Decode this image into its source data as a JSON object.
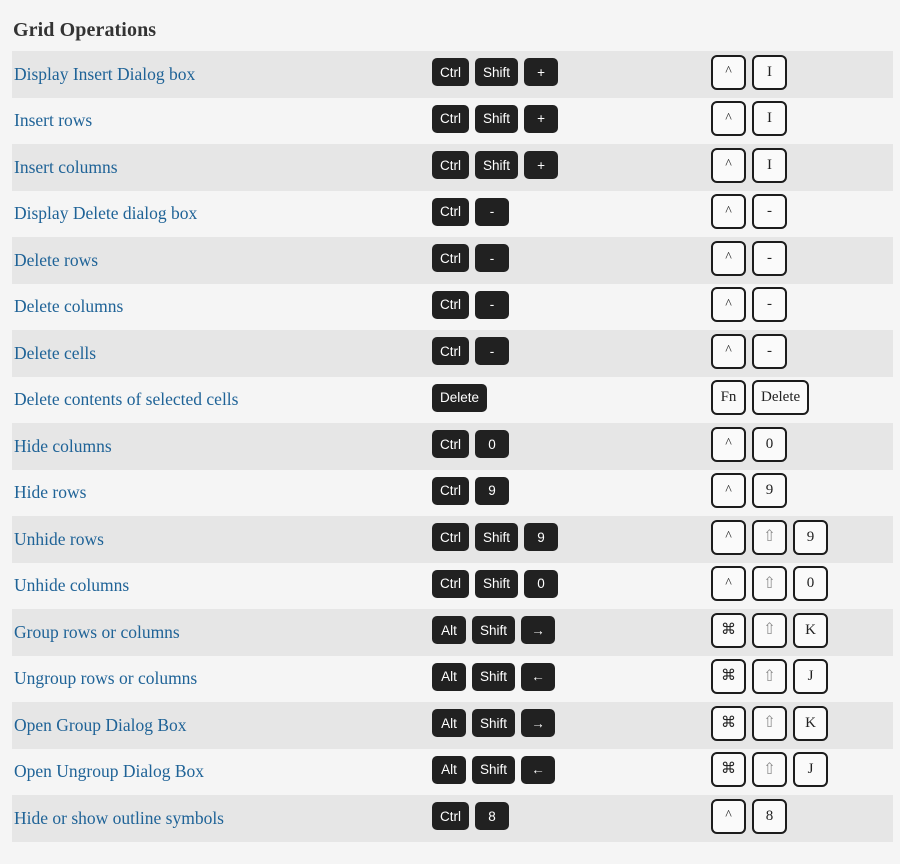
{
  "page": {
    "title": "Grid Operations",
    "link_color": "#1f6397",
    "row_stripe_color": "#e6e6e6",
    "background_color": "#f5f5f5",
    "dark_key_color": "#212121",
    "light_key_border_color": "#1c1c1c"
  },
  "rows": [
    {
      "description": "Display Insert Dialog box",
      "windows": [
        "Ctrl",
        "Shift",
        "+"
      ],
      "mac": [
        "^",
        "I"
      ]
    },
    {
      "description": "Insert rows",
      "windows": [
        "Ctrl",
        "Shift",
        "+"
      ],
      "mac": [
        "^",
        "I"
      ]
    },
    {
      "description": "Insert columns",
      "windows": [
        "Ctrl",
        "Shift",
        "+"
      ],
      "mac": [
        "^",
        "I"
      ]
    },
    {
      "description": "Display Delete dialog box",
      "windows": [
        "Ctrl",
        "-"
      ],
      "mac": [
        "^",
        "-"
      ]
    },
    {
      "description": "Delete rows",
      "windows": [
        "Ctrl",
        "-"
      ],
      "mac": [
        "^",
        "-"
      ]
    },
    {
      "description": "Delete columns",
      "windows": [
        "Ctrl",
        "-"
      ],
      "mac": [
        "^",
        "-"
      ]
    },
    {
      "description": "Delete cells",
      "windows": [
        "Ctrl",
        "-"
      ],
      "mac": [
        "^",
        "-"
      ]
    },
    {
      "description": "Delete contents of selected cells",
      "windows": [
        "Delete"
      ],
      "mac": [
        "Fn",
        "Delete"
      ]
    },
    {
      "description": "Hide columns",
      "windows": [
        "Ctrl",
        "0"
      ],
      "mac": [
        "^",
        "0"
      ]
    },
    {
      "description": "Hide rows",
      "windows": [
        "Ctrl",
        "9"
      ],
      "mac": [
        "^",
        "9"
      ]
    },
    {
      "description": "Unhide rows",
      "windows": [
        "Ctrl",
        "Shift",
        "9"
      ],
      "mac": [
        "^",
        "⇧",
        "9"
      ]
    },
    {
      "description": "Unhide columns",
      "windows": [
        "Ctrl",
        "Shift",
        "0"
      ],
      "mac": [
        "^",
        "⇧",
        "0"
      ]
    },
    {
      "description": "Group rows or columns",
      "windows": [
        "Alt",
        "Shift",
        "→"
      ],
      "mac": [
        "⌘",
        "⇧",
        "K"
      ]
    },
    {
      "description": "Ungroup rows or columns",
      "windows": [
        "Alt",
        "Shift",
        "←"
      ],
      "mac": [
        "⌘",
        "⇧",
        "J"
      ]
    },
    {
      "description": "Open Group Dialog Box",
      "windows": [
        "Alt",
        "Shift",
        "→"
      ],
      "mac": [
        "⌘",
        "⇧",
        "K"
      ]
    },
    {
      "description": "Open Ungroup Dialog Box",
      "windows": [
        "Alt",
        "Shift",
        "←"
      ],
      "mac": [
        "⌘",
        "⇧",
        "J"
      ]
    },
    {
      "description": "Hide or show outline symbols",
      "windows": [
        "Ctrl",
        "8"
      ],
      "mac": [
        "^",
        "8"
      ]
    }
  ]
}
